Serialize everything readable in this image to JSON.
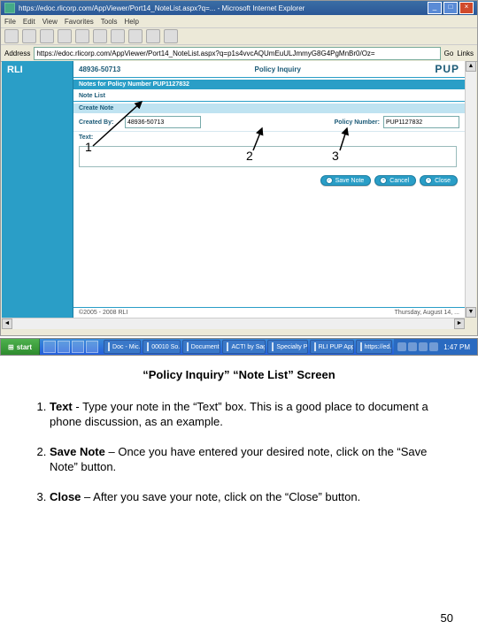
{
  "browser": {
    "title": "https://edoc.rlicorp.com/AppViewer/Port14_NoteList.aspx?q=... - Microsoft Internet Explorer",
    "menu": [
      "File",
      "Edit",
      "View",
      "Favorites",
      "Tools",
      "Help"
    ],
    "address_label": "Address",
    "url": "https://edoc.rlicorp.com/AppViewer/Port14_NoteList.aspx?q=p1s4vvcAQUmEuULJmmyG8G4PgMnBr0/Oz=",
    "go_label": "Go",
    "links_label": "Links"
  },
  "page": {
    "brand": "RLI",
    "agent_code": "48936-50713",
    "header_center": "Policy Inquiry",
    "brand_right": "PUP",
    "notes_bar": "Notes for Policy Number PUP1127832",
    "note_list_label": "Note List",
    "create_note_label": "Create Note",
    "created_by_label": "Created By:",
    "created_by_value": "48936-50713",
    "policy_number_label": "Policy Number:",
    "policy_number_value": "PUP1127832",
    "text_label": "Text:",
    "buttons": {
      "save": "Save Note",
      "cancel": "Cancel",
      "close": "Close"
    },
    "footer_left": "©2005 - 2008 RLI",
    "footer_right": "Thursday, August 14, ..."
  },
  "taskbar": {
    "start": "start",
    "tasks": [
      "Doc - Mic...",
      "00010 So...",
      "Document...",
      "ACT! by Sag...",
      "Specialty P...",
      "RLI PUP App...",
      "https://ed..."
    ],
    "clock": "1:47 PM"
  },
  "callouts": {
    "n1": "1",
    "n2": "2",
    "n3": "3"
  },
  "doc": {
    "title": "“Policy Inquiry” “Note List” Screen",
    "items": [
      {
        "lead": "Text",
        "body": " - Type your note in the “Text” box.  This is a good place to document a phone discussion, as an example."
      },
      {
        "lead": "Save Note",
        "body": " – Once you have entered your desired note, click on the “Save Note” button."
      },
      {
        "lead": "Close",
        "body": " – After you save your note, click on the “Close” button."
      }
    ],
    "page_number": "50"
  }
}
